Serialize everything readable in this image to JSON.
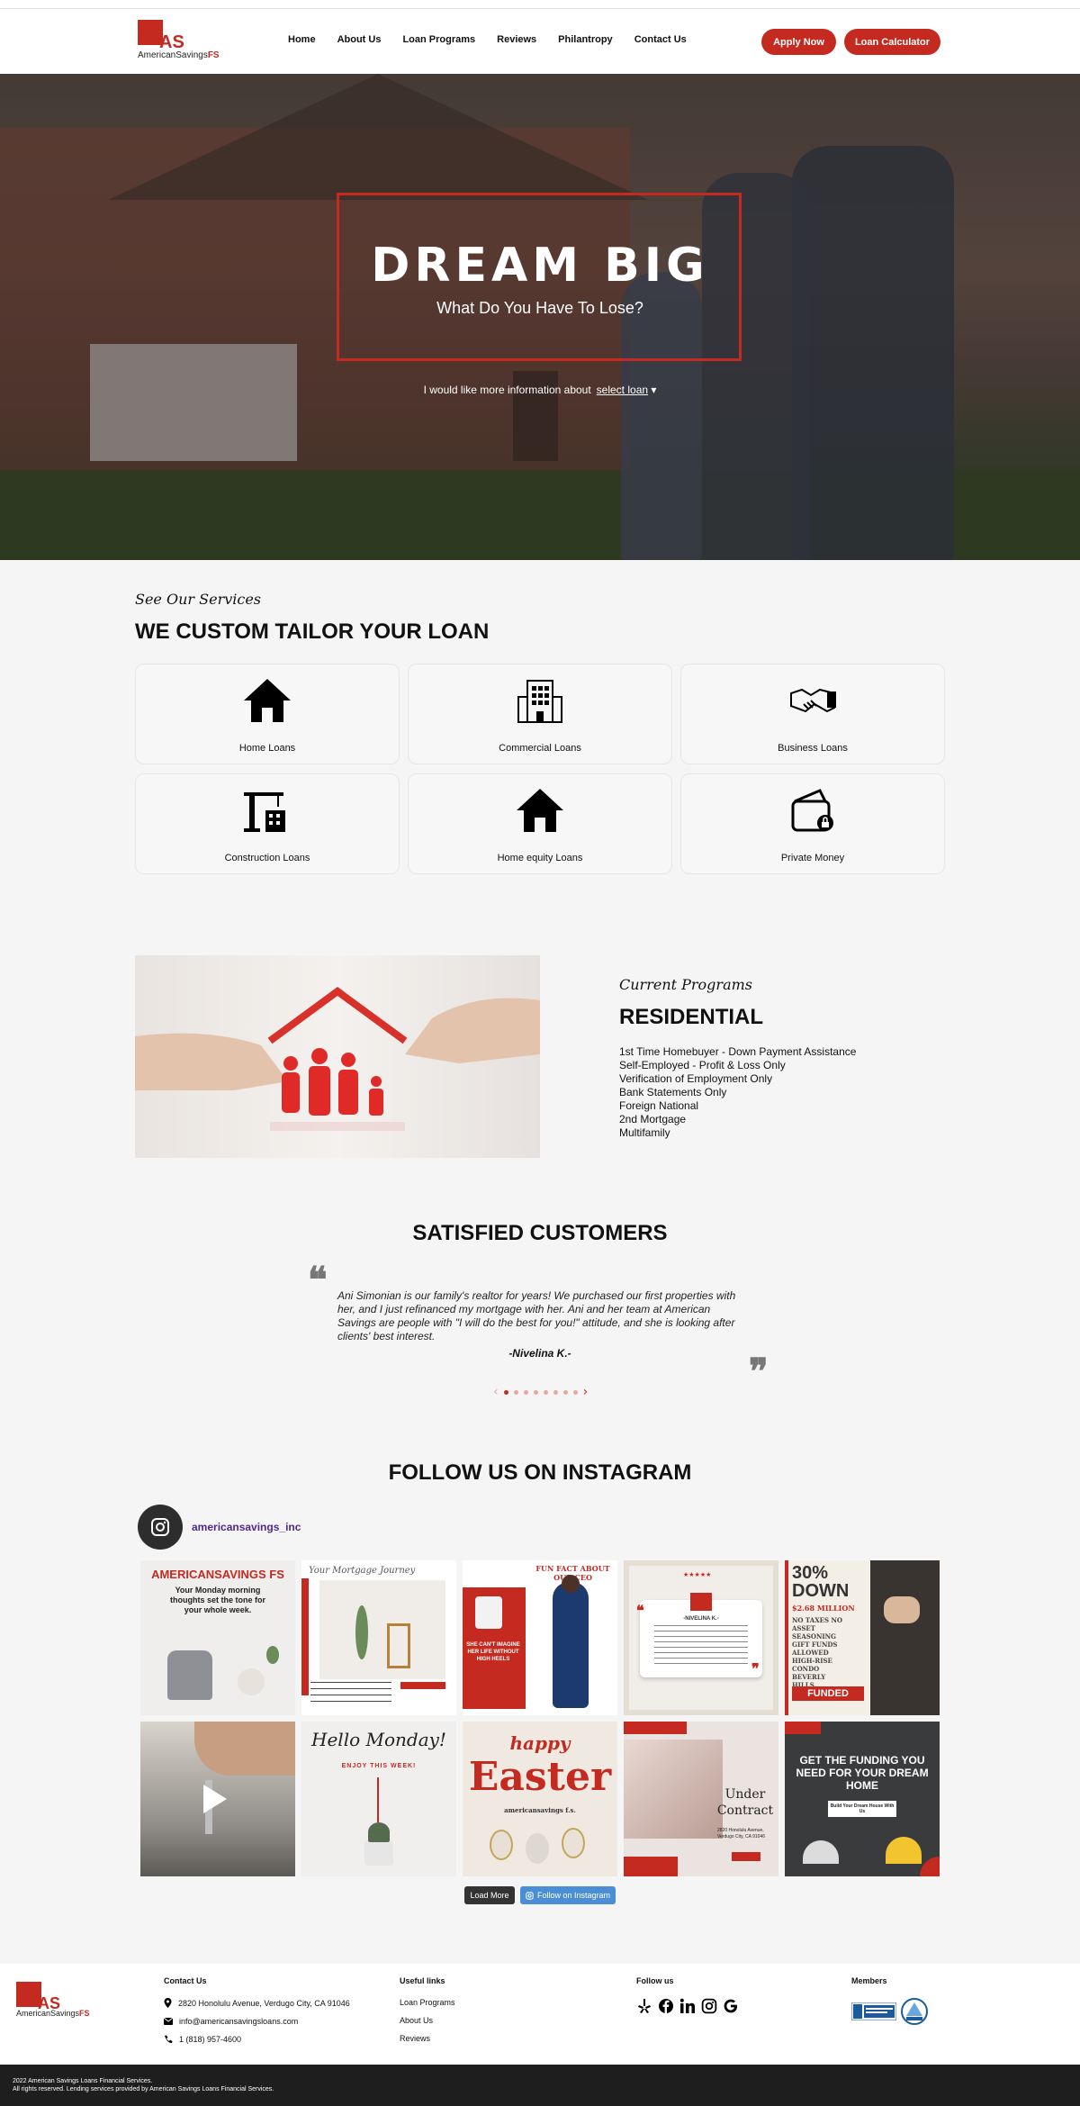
{
  "header": {
    "logo_mark": "AS",
    "logo_word": "AmericanSavings",
    "logo_word_suffix": "FS",
    "nav": [
      "Home",
      "About Us",
      "Loan Programs",
      "Reviews",
      "Philantropy",
      "Contact Us"
    ],
    "apply_label": "Apply Now",
    "calculator_label": "Loan Calculator",
    "accent_color": "#c42a20"
  },
  "hero": {
    "title": "DREAM BIG",
    "subtitle": "What Do You Have To Lose?",
    "info_text": "I would like more information about",
    "select_value": "select loan"
  },
  "services": {
    "script": "See Our Services",
    "title": "WE CUSTOM TAILOR YOUR LOAN",
    "items": [
      {
        "label": "Home Loans",
        "icon": "house-icon"
      },
      {
        "label": "Commercial Loans",
        "icon": "building-icon"
      },
      {
        "label": "Business Loans",
        "icon": "handshake-icon"
      },
      {
        "label": "Construction Loans",
        "icon": "crane-icon"
      },
      {
        "label": "Home equity Loans",
        "icon": "house-icon"
      },
      {
        "label": "Private Money",
        "icon": "wallet-icon"
      }
    ]
  },
  "programs": {
    "script": "Current Programs",
    "title": "RESIDENTIAL",
    "items": [
      "1st Time Homebuyer - Down Payment Assistance",
      "Self-Employed - Profit & Loss Only",
      "Verification of Employment Only",
      "Bank Statements Only",
      "Foreign National",
      "2nd Mortgage",
      "Multifamily"
    ]
  },
  "customers": {
    "title": "SATISFIED CUSTOMERS",
    "quote": "Ani Simonian is our family's realtor for years! We purchased our first properties with her, and I just refinanced my mortgage with her. Ani and her team at American Savings are people with \"I will do the best for you!\" attitude, and she is looking after clients' best interest.",
    "author": "-Nivelina K.-",
    "dots": 8,
    "active_dot": 1
  },
  "instagram": {
    "title": "FOLLOW US ON INSTAGRAM",
    "handle": "americansavings_inc",
    "load_more": "Load More",
    "follow": "Follow on Instagram",
    "tiles": [
      {
        "kind": "monday",
        "line1": "AMERICANSAVINGS FS",
        "line2": "Your Monday morning thoughts set the tone for your whole week."
      },
      {
        "kind": "journey",
        "line1": "Your Mortgage Journey"
      },
      {
        "kind": "ceo",
        "line1": "FUN FACT ABOUT OUR CEO",
        "line2": "SHE CAN'T IMAGINE HER LIFE WITHOUT HIGH HEELS"
      },
      {
        "kind": "review",
        "line1": "-NIVELINA K.-"
      },
      {
        "kind": "funded",
        "line1": "30% DOWN",
        "line2": "$2.68 MILLION",
        "line3": "NO TAXES NO ASSET SEASONING GIFT FUNDS ALLOWED HIGH-RISE CONDO BEVERLY HILLS",
        "line4": "FUNDED"
      },
      {
        "kind": "keys"
      },
      {
        "kind": "hello",
        "line1": "Hello Monday!",
        "line2": "ENJOY THIS WEEK!"
      },
      {
        "kind": "easter",
        "line1": "happy",
        "line2": "Easter",
        "line3": "americansavings f.s."
      },
      {
        "kind": "contract",
        "line1": "Under Contract",
        "line2": "2820 Honolulu Avenue, Verdugo City, CA 91046"
      },
      {
        "kind": "funding",
        "line1": "GET THE FUNDING YOU NEED FOR YOUR DREAM HOME",
        "line2": "Build Your Dream House With Us"
      }
    ]
  },
  "footer": {
    "contact_title": "Contact Us",
    "address": "2820 Honolulu Avenue, Verdugo City, CA 91046",
    "email": "info@americansavingsloans.com",
    "phone": "1 (818) 957-4600",
    "links_title": "Useful links",
    "links": [
      "Loan Programs",
      "About Us",
      "Reviews"
    ],
    "follow_title": "Follow us",
    "members_title": "Members",
    "copyright_1": "2022 American Savings Loans Financial Services.",
    "copyright_2": "All rights reserved. Lending services provided by American Savings Loans Financial Services."
  }
}
